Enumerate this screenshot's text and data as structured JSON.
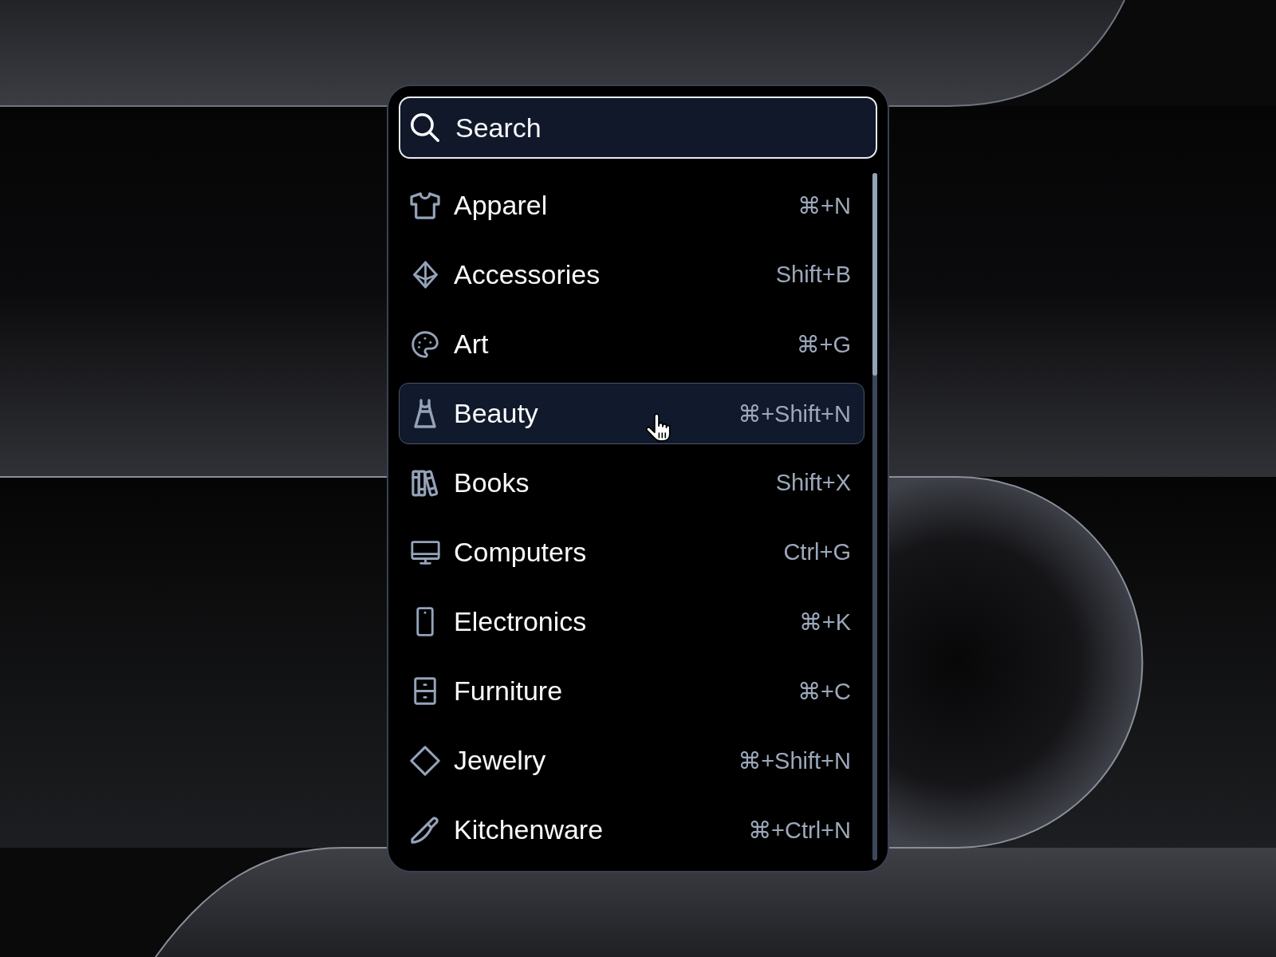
{
  "search": {
    "placeholder": "Search"
  },
  "items": [
    {
      "label": "Apparel",
      "shortcut": "⌘+N",
      "selected": false
    },
    {
      "label": "Accessories",
      "shortcut": "Shift+B",
      "selected": false
    },
    {
      "label": "Art",
      "shortcut": "⌘+G",
      "selected": false
    },
    {
      "label": "Beauty",
      "shortcut": "⌘+Shift+N",
      "selected": true
    },
    {
      "label": "Books",
      "shortcut": "Shift+X",
      "selected": false
    },
    {
      "label": "Computers",
      "shortcut": "Ctrl+G",
      "selected": false
    },
    {
      "label": "Electronics",
      "shortcut": "⌘+K",
      "selected": false
    },
    {
      "label": "Furniture",
      "shortcut": "⌘+C",
      "selected": false
    },
    {
      "label": "Jewelry",
      "shortcut": "⌘+Shift+N",
      "selected": false
    },
    {
      "label": "Kitchenware",
      "shortcut": "⌘+Ctrl+N",
      "selected": false
    }
  ]
}
